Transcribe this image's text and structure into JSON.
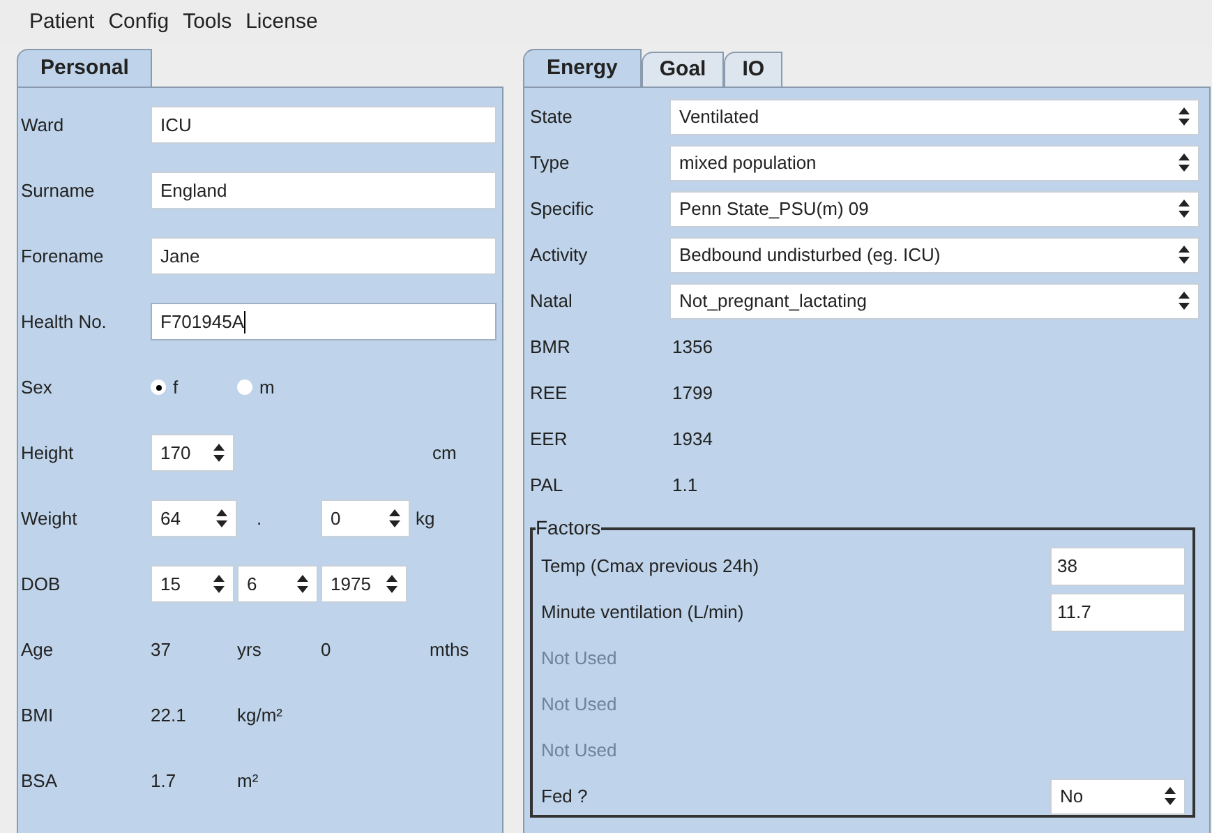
{
  "menu": [
    {
      "label": "Patient"
    },
    {
      "label": "Config"
    },
    {
      "label": "Tools"
    },
    {
      "label": "License"
    }
  ],
  "left_panel": {
    "tabs": [
      {
        "label": "Personal",
        "selected": true
      }
    ],
    "rows": [
      {
        "kind": "text",
        "label": "Ward",
        "value": "ICU",
        "focused": false
      },
      {
        "kind": "text",
        "label": "Surname",
        "value": "England",
        "focused": false
      },
      {
        "kind": "text",
        "label": "Forename",
        "value": "Jane",
        "focused": false
      },
      {
        "kind": "text",
        "label": "Health No.",
        "value": "F701945A",
        "focused": true
      },
      {
        "kind": "radio",
        "label": "Sex",
        "options": [
          {
            "label": "f",
            "selected": true
          },
          {
            "label": "m",
            "selected": false
          }
        ]
      },
      {
        "kind": "spinners",
        "label": "Height",
        "spinners": [
          {
            "value": "170"
          }
        ],
        "unit": "cm"
      },
      {
        "kind": "spinners",
        "label": "Weight",
        "spinners": [
          {
            "value": "64"
          },
          {
            "value": "0"
          }
        ],
        "separator": ".",
        "unit": "kg"
      },
      {
        "kind": "spinners",
        "label": "DOB",
        "spinners": [
          {
            "value": "15"
          },
          {
            "value": "6"
          },
          {
            "value": "1975"
          }
        ]
      },
      {
        "kind": "readout",
        "label": "Age",
        "parts": [
          "37",
          "yrs",
          "0",
          "mths"
        ]
      },
      {
        "kind": "readout",
        "label": "BMI",
        "parts": [
          "22.1",
          "kg/m²"
        ]
      },
      {
        "kind": "readout",
        "label": "BSA",
        "parts": [
          "1.7",
          "m²"
        ]
      }
    ]
  },
  "right_panel": {
    "tabs": [
      {
        "label": "Energy",
        "selected": true
      },
      {
        "label": "Goal",
        "selected": false
      },
      {
        "label": "IO",
        "selected": false
      }
    ],
    "rows": [
      {
        "kind": "select",
        "label": "State",
        "value": "Ventilated"
      },
      {
        "kind": "select",
        "label": "Type",
        "value": "mixed population"
      },
      {
        "kind": "select",
        "label": "Specific",
        "value": "Penn State_PSU(m) 09"
      },
      {
        "kind": "select",
        "label": "Activity",
        "value": "Bedbound undisturbed (eg. ICU)"
      },
      {
        "kind": "select",
        "label": "Natal",
        "value": "Not_pregnant_lactating"
      },
      {
        "kind": "readout",
        "label": "BMR",
        "value": "1356"
      },
      {
        "kind": "readout",
        "label": "REE",
        "value": "1799"
      },
      {
        "kind": "readout",
        "label": "EER",
        "value": "1934"
      },
      {
        "kind": "readout",
        "label": "PAL",
        "value": "1.1"
      }
    ],
    "factors": {
      "title": "Factors",
      "rows": [
        {
          "kind": "input",
          "label": "Temp (Cmax previous 24h)",
          "value": "38"
        },
        {
          "kind": "input",
          "label": "Minute ventilation (L/min)",
          "value": "11.7"
        },
        {
          "kind": "unused",
          "label": "Not Used"
        },
        {
          "kind": "unused",
          "label": "Not Used"
        },
        {
          "kind": "unused",
          "label": "Not Used"
        },
        {
          "kind": "select",
          "label": "Fed ?",
          "value": "No"
        }
      ]
    }
  }
}
